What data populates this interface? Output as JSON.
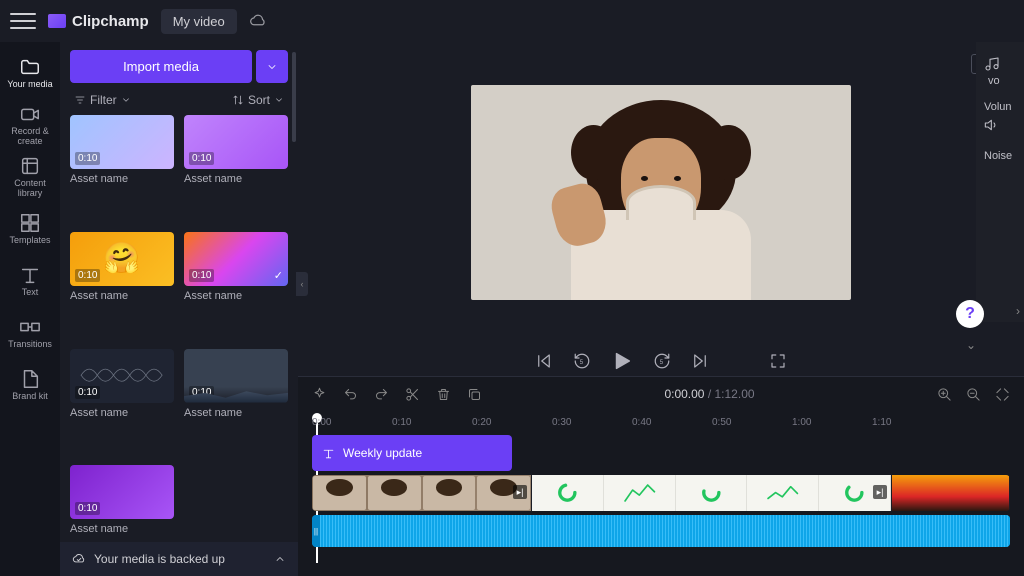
{
  "app": {
    "name": "Clipchamp",
    "project": "My video"
  },
  "rail": [
    {
      "label": "Your media",
      "icon": "folder"
    },
    {
      "label": "Record & create",
      "icon": "camera"
    },
    {
      "label": "Content library",
      "icon": "library"
    },
    {
      "label": "Templates",
      "icon": "templates"
    },
    {
      "label": "Text",
      "icon": "text"
    },
    {
      "label": "Transitions",
      "icon": "transitions"
    },
    {
      "label": "Brand kit",
      "icon": "brand"
    }
  ],
  "panel": {
    "import": "Import media",
    "filter": "Filter",
    "sort": "Sort",
    "backup": "Your media is backed up",
    "assets": [
      {
        "dur": "0:10",
        "name": "Asset name",
        "cls": "t0"
      },
      {
        "dur": "0:10",
        "name": "Asset name",
        "cls": "t1"
      },
      {
        "dur": "0:10",
        "name": "Asset name",
        "cls": "t2"
      },
      {
        "dur": "0:10",
        "name": "Asset name",
        "cls": "t3",
        "check": true
      },
      {
        "dur": "0:10",
        "name": "Asset name",
        "cls": "t4"
      },
      {
        "dur": "0:10",
        "name": "Asset name",
        "cls": "t5"
      },
      {
        "dur": "0:10",
        "name": "Asset name",
        "cls": "t6"
      }
    ]
  },
  "preview": {
    "aspect": "16:9"
  },
  "timeline": {
    "current": "0:00.00",
    "duration": "1:12.00",
    "ticks": [
      "0:00",
      "0:10",
      "0:20",
      "0:30",
      "0:40",
      "0:50",
      "1:00",
      "1:10"
    ],
    "text_clip": "Weekly update"
  },
  "side": {
    "vol_label": "Volun",
    "noise_label": "Noise",
    "vo": "vo"
  }
}
